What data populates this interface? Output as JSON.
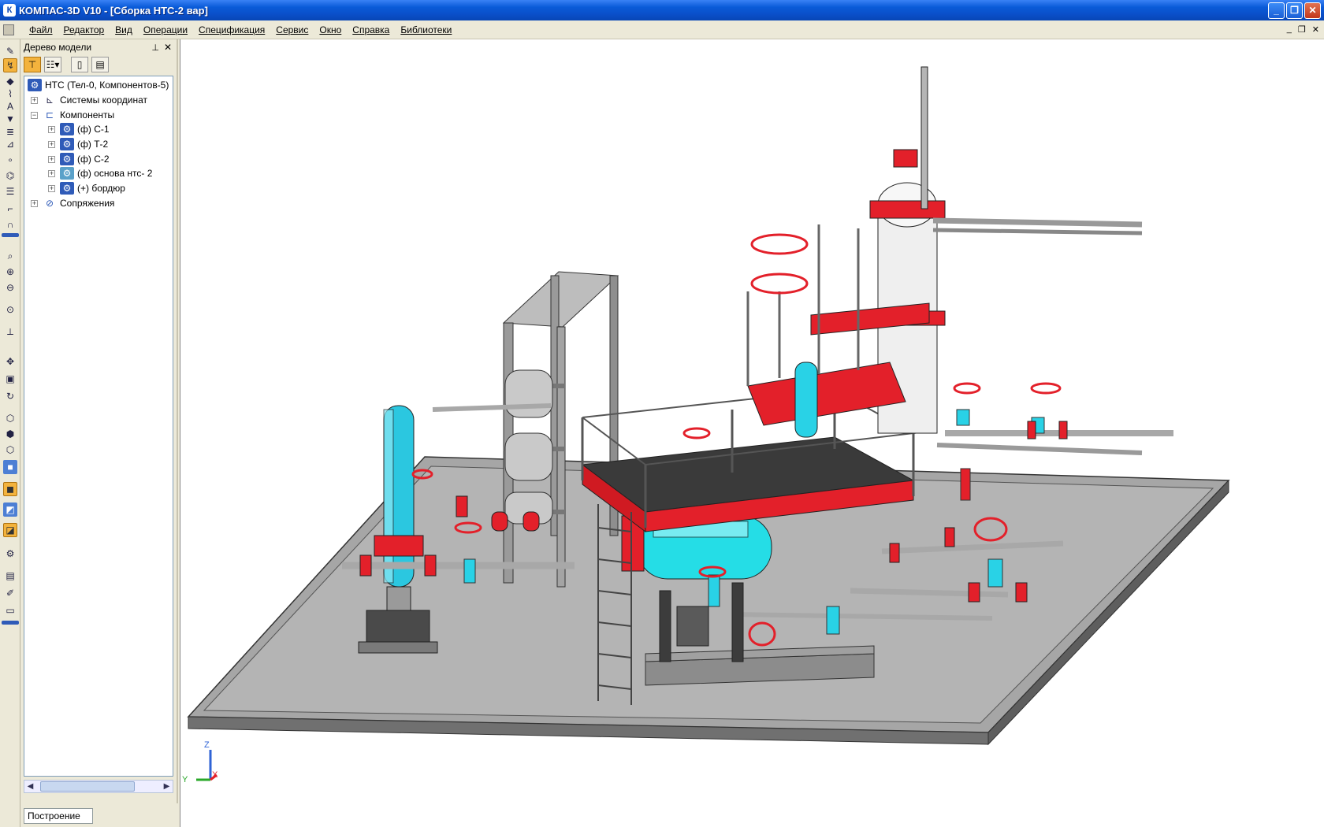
{
  "window": {
    "title": "КОМПАС-3D V10 - [Сборка НТС-2 вар]",
    "buttons": [
      "minimize",
      "restore",
      "close"
    ]
  },
  "menu": {
    "items": [
      "Файл",
      "Редактор",
      "Вид",
      "Операции",
      "Спецификация",
      "Сервис",
      "Окно",
      "Справка",
      "Библиотеки"
    ]
  },
  "tree_panel": {
    "title": "Дерево модели",
    "root": "НТС (Тел-0, Компонентов-5)",
    "items": [
      {
        "label": "Системы координат"
      },
      {
        "label": "Компоненты"
      },
      {
        "label": "(ф) С-1"
      },
      {
        "label": "(ф) Т-2"
      },
      {
        "label": "(ф) С-2"
      },
      {
        "label": "(ф) основа нтс- 2"
      },
      {
        "label": "(+) бордюр"
      },
      {
        "label": "Сопряжения"
      }
    ]
  },
  "bottom_tab": {
    "label": "Построение"
  },
  "axes": {
    "z": "Z",
    "y": "Y",
    "x": "X"
  },
  "colors": {
    "title_bar": "#0A4FC9",
    "chrome": "#ECE9D8",
    "pipe_gray": "#B8B8B8",
    "vessel_cyan": "#27D8E8",
    "flange_red": "#E3202A",
    "platform": "#8E8E8E"
  }
}
